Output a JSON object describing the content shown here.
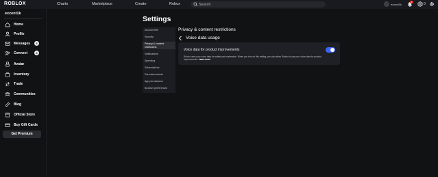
{
  "topbar": {
    "logo": "ROBLOX",
    "nav": [
      "Charts",
      "Marketplace",
      "Create",
      "Robux"
    ],
    "search_placeholder": "Search",
    "username": "excent1k",
    "notification_count": "4",
    "robux_count": "0"
  },
  "sidebar": {
    "username": "excent1k",
    "items": [
      {
        "label": "Home",
        "icon": "home-icon"
      },
      {
        "label": "Profile",
        "icon": "profile-icon"
      },
      {
        "label": "Messages",
        "icon": "messages-icon",
        "badge": "3"
      },
      {
        "label": "Connect",
        "icon": "connect-icon",
        "badge": "4"
      },
      {
        "label": "Avatar",
        "icon": "avatar-icon"
      },
      {
        "label": "Inventory",
        "icon": "inventory-icon"
      },
      {
        "label": "Trade",
        "icon": "trade-icon"
      },
      {
        "label": "Communities",
        "icon": "communities-icon"
      },
      {
        "label": "Blog",
        "icon": "blog-icon"
      },
      {
        "label": "Official Store",
        "icon": "store-icon"
      },
      {
        "label": "Buy Gift Cards",
        "icon": "gift-card-icon"
      }
    ],
    "premium_label": "Get Premium"
  },
  "settings": {
    "title": "Settings",
    "nav": [
      "Account Info",
      "Security",
      "Privacy & content restrictions",
      "Notifications",
      "Spending",
      "Subscriptions",
      "Parental controls",
      "App permissions",
      "Browser preferences"
    ],
    "active_index": 2,
    "section_title": "Privacy & content restrictions",
    "sub_title": "Voice data usage",
    "panel": {
      "label": "Voice data for product improvements",
      "toggle_on": true,
      "description": "Roblox uses your voice data for safety and moderation. When you turn on this setting, you also allow Roblox to use your voice data for product improvements.",
      "learn_more": "Learn more"
    }
  },
  "colors": {
    "background": "#111214",
    "topbar": "#191a1f",
    "panel": "#1f2026",
    "toggle_accent": "#3c64f2",
    "badge_red": "#e02a2a"
  }
}
